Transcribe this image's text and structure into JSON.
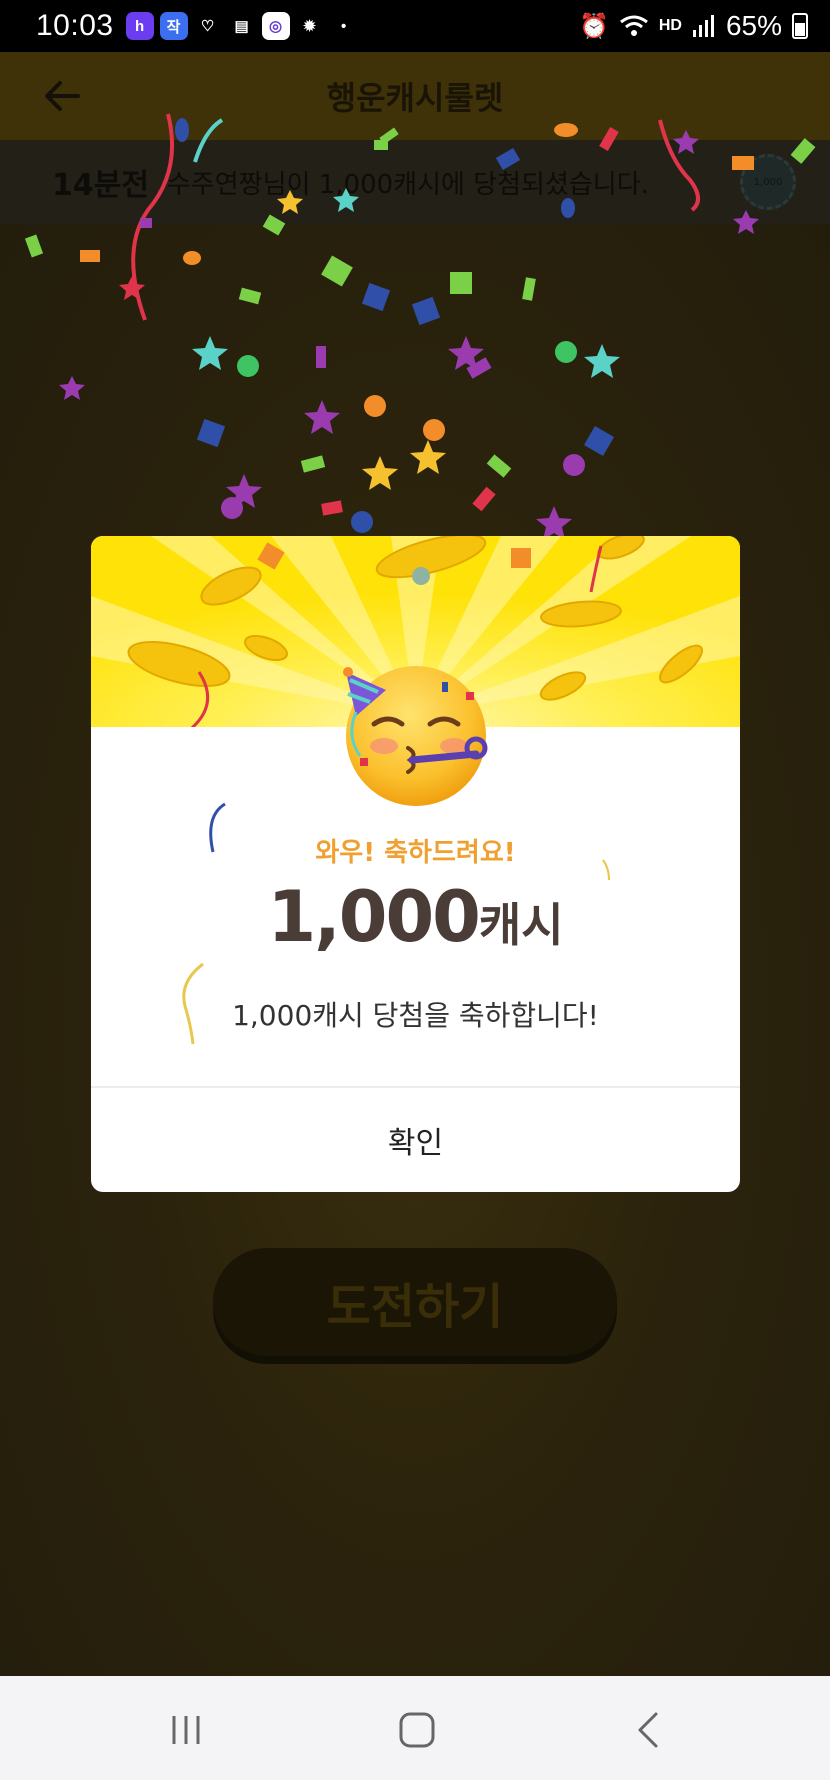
{
  "status_bar": {
    "time": "10:03",
    "app_icons": [
      "h",
      "작",
      "♡",
      "▤",
      "◎",
      "✹",
      "•"
    ],
    "network": "HD",
    "battery": "65%"
  },
  "header": {
    "title": "행운캐시룰렛"
  },
  "ticker": {
    "time_ago": "14분전",
    "message": "수주연짱님이 1,000캐시에 당첨되셨습니다.",
    "coin_label": "1,000"
  },
  "challenge_button": {
    "label": "도전하기"
  },
  "modal": {
    "subtitle": "와우! 축하드려요!",
    "amount": "1,000",
    "unit": "캐시",
    "description": "1,000캐시 당첨을 축하합니다!",
    "confirm_label": "확인"
  },
  "colors": {
    "modal_top": "#ffe208",
    "subtitle": "#f0a030",
    "amount": "#4a3c36",
    "dim_background": "#2a2210"
  }
}
